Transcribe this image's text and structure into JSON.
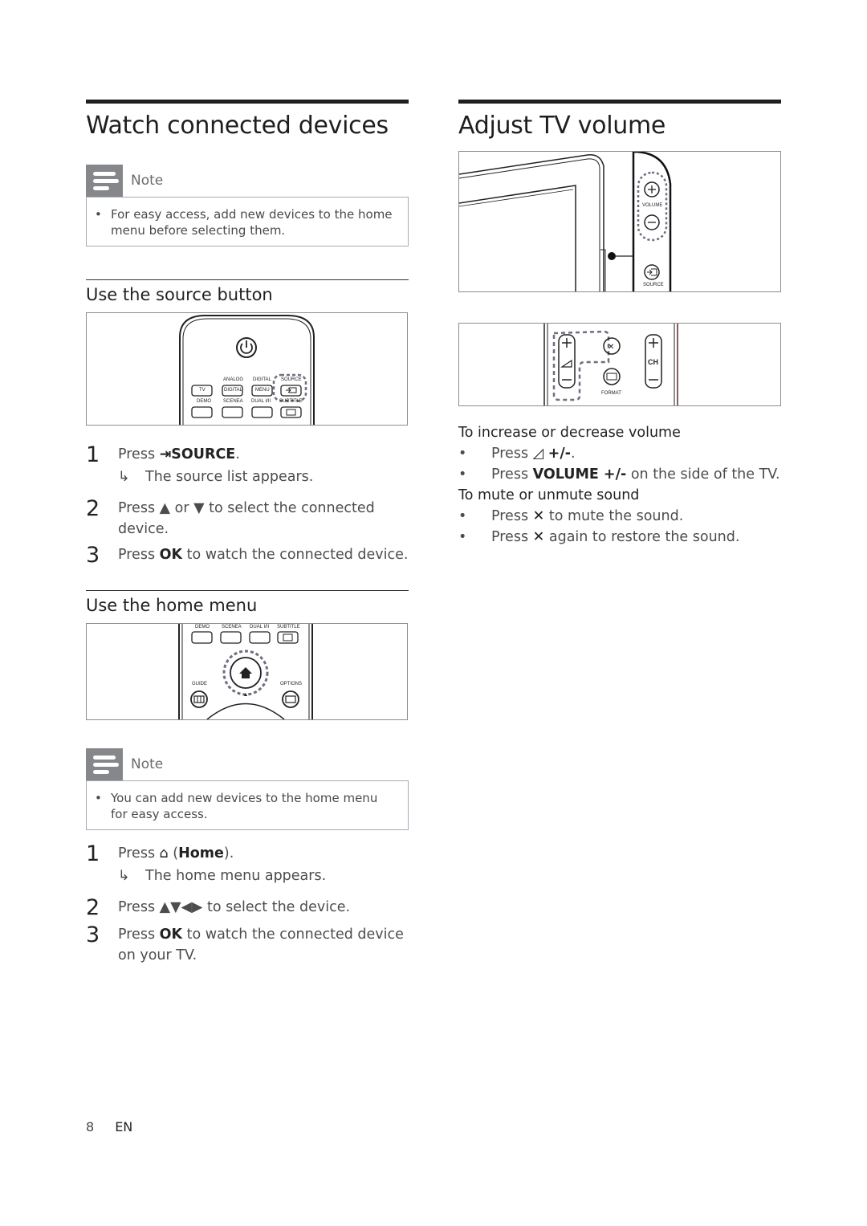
{
  "left": {
    "title": "Watch connected devices",
    "note1": {
      "label": "Note",
      "text": "For easy access, add new devices to the home menu before selecting them."
    },
    "section1": {
      "heading": "Use the source button",
      "remote_labels": {
        "analog": "ANALOG",
        "digital_top": "DIGITAL",
        "source": "SOURCE",
        "tv": "TV",
        "digital": "DIGITAL",
        "menu": "MENU",
        "demo": "DEMO",
        "scenea": "SCENEA",
        "dual": "DUAL I/II",
        "subtitle": "SUBTITLE"
      },
      "steps": [
        {
          "num": "1",
          "pre": "Press ",
          "icon": "⊕",
          "bold": "SOURCE",
          "post": ".",
          "result": "The source list appears."
        },
        {
          "num": "2",
          "text": "Press ▲ or ▼ to select the connected device."
        },
        {
          "num": "3",
          "pre": "Press ",
          "bold": "OK",
          "post": " to watch the connected device."
        }
      ]
    },
    "section2": {
      "heading": "Use the home menu",
      "remote_labels": {
        "demo": "DEMO",
        "scenea": "SCENEA",
        "dual": "DUAL I/II",
        "subtitle": "SUBTITLE",
        "guide": "GUIDE",
        "options": "OPTIONS"
      },
      "note": {
        "label": "Note",
        "text": "You can add new devices to the home menu for easy access."
      },
      "steps": [
        {
          "num": "1",
          "pre": "Press ",
          "icon": "⌂",
          "mid": " (",
          "bold": "Home",
          "post": ").",
          "result": "The home menu appears."
        },
        {
          "num": "2",
          "text": "Press ▲▼◀▶ to select the device."
        },
        {
          "num": "3",
          "pre": "Press ",
          "bold": "OK",
          "post": " to watch the connected device on your TV."
        }
      ]
    }
  },
  "right": {
    "title": "Adjust TV volume",
    "tv_labels": {
      "volume": "VOLUME",
      "source": "SOURCE"
    },
    "remote_labels": {
      "ch": "CH",
      "format": "FORMAT"
    },
    "increase_heading": "To increase or decrease volume",
    "increase_items": [
      {
        "pre": "Press ",
        "icon": "◿",
        "bold": "+/-",
        "post": "."
      },
      {
        "pre": "Press ",
        "bold": "VOLUME +/-",
        "post": " on the side of the TV."
      }
    ],
    "mute_heading": "To mute or unmute sound",
    "mute_items": [
      {
        "pre": "Press ",
        "icon": "🔇",
        "post": " to mute the sound."
      },
      {
        "pre": "Press ",
        "icon": "🔇",
        "post": " again to restore the sound."
      }
    ]
  },
  "footer": {
    "page": "8",
    "lang": "EN"
  }
}
